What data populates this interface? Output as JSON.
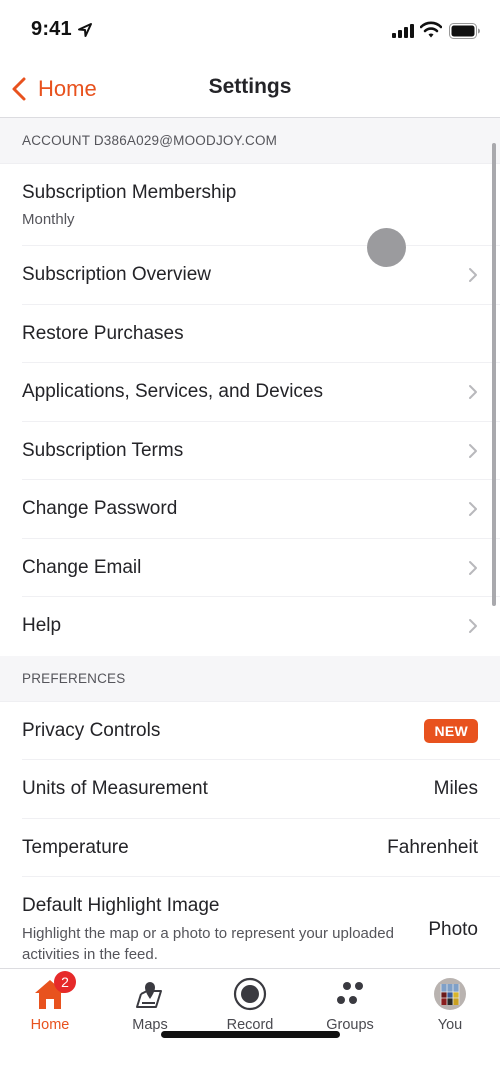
{
  "status_bar": {
    "time": "9:41"
  },
  "nav": {
    "back_label": "Home",
    "title": "Settings"
  },
  "account_section": {
    "header": "ACCOUNT D386A029@MOODJOY.COM",
    "rows": [
      {
        "label": "Subscription Membership",
        "sub": "Monthly"
      },
      {
        "label": "Subscription Overview"
      },
      {
        "label": "Restore Purchases"
      },
      {
        "label": "Applications, Services, and Devices"
      },
      {
        "label": "Subscription Terms"
      },
      {
        "label": "Change Password"
      },
      {
        "label": "Change Email"
      },
      {
        "label": "Help"
      }
    ]
  },
  "preferences_section": {
    "header": "PREFERENCES",
    "privacy": {
      "label": "Privacy Controls",
      "badge": "NEW"
    },
    "units": {
      "label": "Units of Measurement",
      "value": "Miles"
    },
    "temperature": {
      "label": "Temperature",
      "value": "Fahrenheit"
    },
    "highlight": {
      "label": "Default Highlight Image",
      "description": "Highlight the map or a photo to represent your uploaded activities in the feed.",
      "value": "Photo"
    }
  },
  "tab_bar": {
    "home": {
      "label": "Home",
      "badge": "2"
    },
    "maps": {
      "label": "Maps"
    },
    "record": {
      "label": "Record"
    },
    "groups": {
      "label": "Groups"
    },
    "you": {
      "label": "You"
    }
  },
  "colors": {
    "accent": "#e8521e",
    "badge_red": "#e62a2a",
    "text": "#242428",
    "secondary": "#55555b"
  }
}
